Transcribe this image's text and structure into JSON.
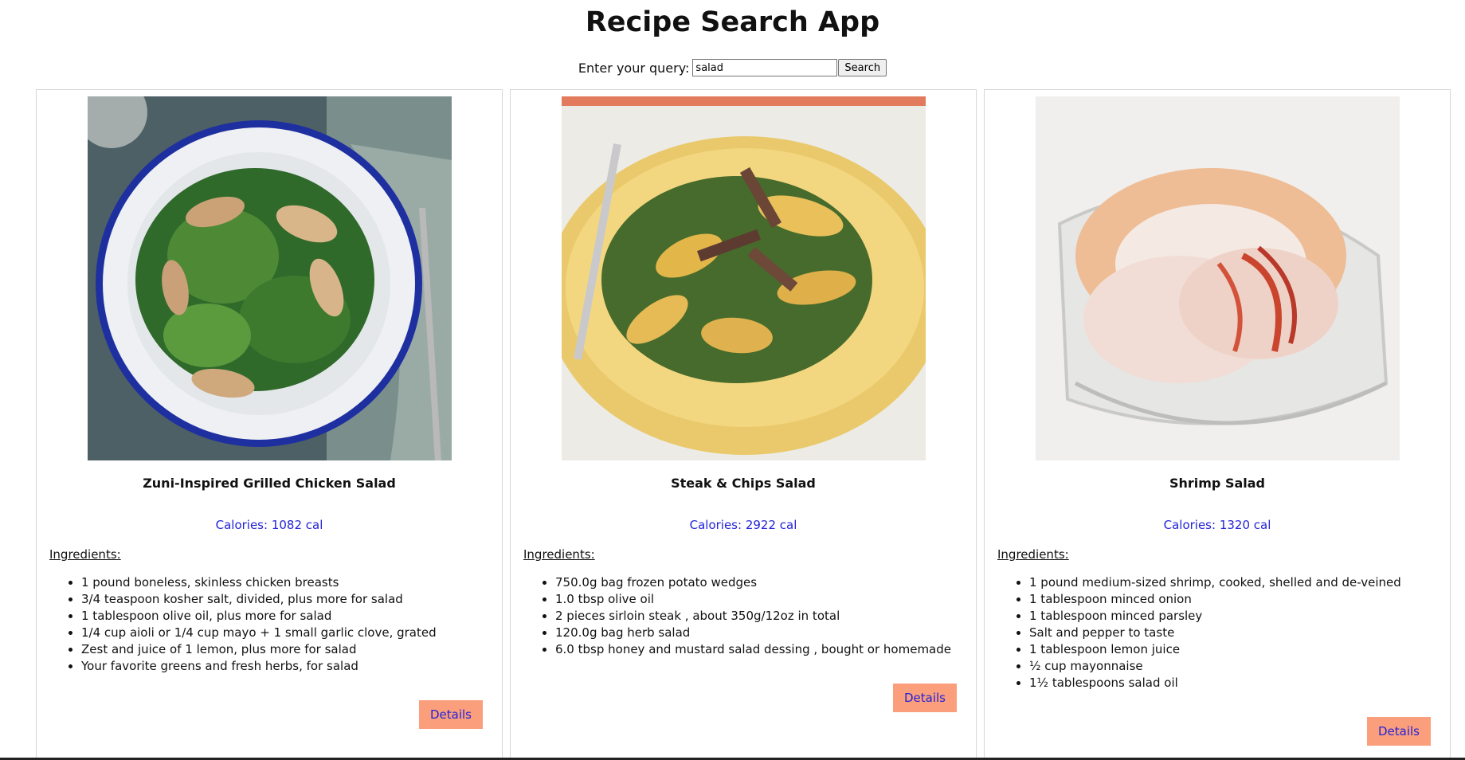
{
  "app": {
    "title": "Recipe Search App"
  },
  "search": {
    "label": "Enter your query:",
    "value": "salad",
    "button_label": "Search"
  },
  "recipes": [
    {
      "title": "Zuni-Inspired Grilled Chicken Salad",
      "calories": "Calories: 1082 cal",
      "ingredients_heading": "Ingredients:",
      "ingredients": [
        "1 pound boneless, skinless chicken breasts",
        "3/4 teaspoon kosher salt, divided, plus more for salad",
        "1 tablespoon olive oil, plus more for salad",
        "1/4 cup aioli or 1/4 cup mayo + 1 small garlic clove, grated",
        "Zest and juice of 1 lemon, plus more for salad",
        "Your favorite greens and fresh herbs, for salad"
      ],
      "details_label": "Details"
    },
    {
      "title": "Steak & Chips Salad",
      "calories": "Calories: 2922 cal",
      "ingredients_heading": "Ingredients:",
      "ingredients": [
        "750.0g bag frozen potato wedges",
        "1.0 tbsp olive oil",
        "2 pieces sirloin steak , about 350g/12oz in total",
        "120.0g bag herb salad",
        "6.0 tbsp honey and mustard salad dessing , bought or homemade"
      ],
      "details_label": "Details"
    },
    {
      "title": "Shrimp Salad",
      "calories": "Calories: 1320 cal",
      "ingredients_heading": "Ingredients:",
      "ingredients": [
        "1 pound medium-sized shrimp, cooked, shelled and de-veined",
        "1 tablespoon minced onion",
        "1 tablespoon minced parsley",
        "Salt and pepper to taste",
        "1 tablespoon lemon juice",
        "½ cup mayonnaise",
        "1½ tablespoons salad oil"
      ],
      "details_label": "Details"
    }
  ]
}
